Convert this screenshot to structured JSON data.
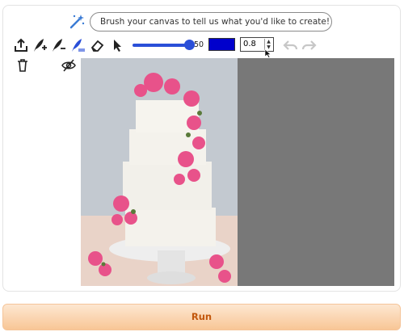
{
  "prompt": {
    "placeholder": "Brush your canvas to tell us what you'd like to create!"
  },
  "toolbar": {
    "brush_size": "50",
    "opacity": "0.8",
    "brush_color": "#0000cc",
    "tools": [
      "upload-icon",
      "feather-add-icon",
      "feather-minus-icon",
      "feather-plus-icon",
      "eraser-icon",
      "pointer-icon"
    ],
    "history": [
      "undo-icon",
      "redo-icon"
    ]
  },
  "layers": [
    "trash-icon",
    "eye-off-icon"
  ],
  "canvas": {
    "mask_color": "#787878"
  },
  "run_button": {
    "label": "Run"
  }
}
